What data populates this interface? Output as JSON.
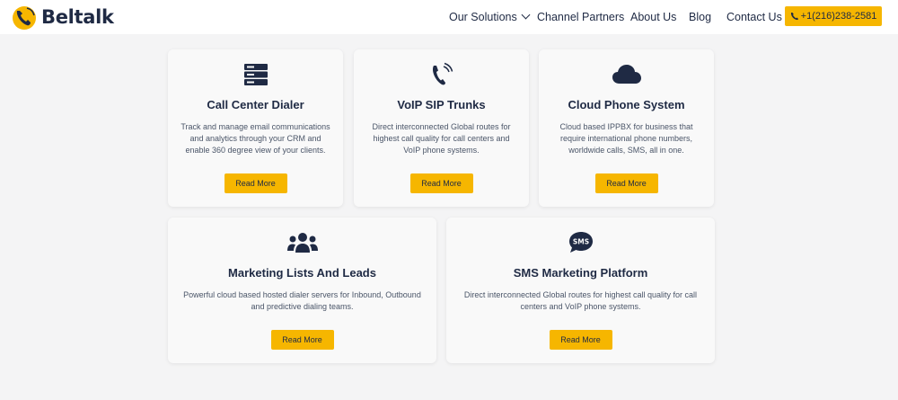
{
  "brand": {
    "name": "Beltalk",
    "accent": "#f6b600",
    "text": "#1f2a44"
  },
  "nav": {
    "items": [
      {
        "label": "Our Solutions",
        "has_dropdown": true
      },
      {
        "label": "Channel Partners"
      },
      {
        "label": "About Us"
      },
      {
        "label": "Blog"
      },
      {
        "label": "Contact Us"
      }
    ],
    "phone": "+1(216)238-2581"
  },
  "cards": [
    {
      "icon": "server-icon",
      "title": "Call Center Dialer",
      "desc": "Track and manage email communications and analytics through your CRM and enable 360 degree view of your clients.",
      "button": "Read More"
    },
    {
      "icon": "phone-ringing-icon",
      "title": "VoIP SIP Trunks",
      "desc": "Direct interconnected Global routes for highest call quality for call centers and VoIP phone systems.",
      "button": "Read More"
    },
    {
      "icon": "cloud-icon",
      "title": "Cloud Phone System",
      "desc": "Cloud based IPPBX for business that require international phone numbers, worldwide calls, SMS, all in one.",
      "button": "Read More"
    },
    {
      "icon": "users-icon",
      "title": "Marketing Lists And Leads",
      "desc": "Powerful cloud based hosted dialer servers for Inbound, Outbound and predictive dialing teams.",
      "button": "Read More"
    },
    {
      "icon": "sms-bubble-icon",
      "title": "SMS Marketing Platform",
      "desc": "Direct interconnected Global routes for highest call quality for call centers and VoIP phone systems.",
      "button": "Read More"
    }
  ]
}
